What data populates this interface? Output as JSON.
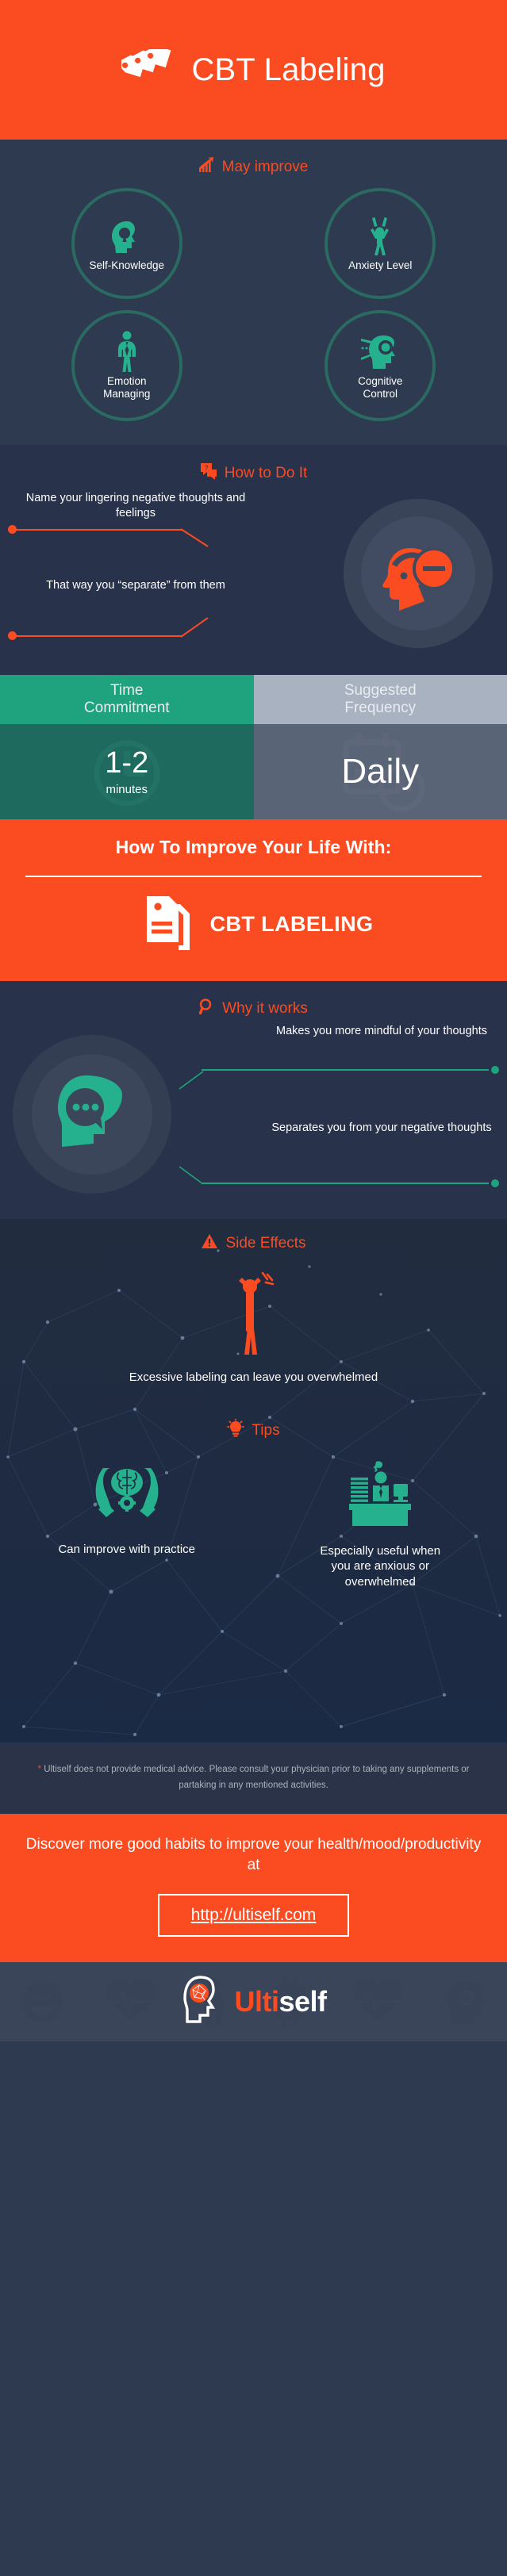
{
  "header": {
    "title": "CBT Labeling",
    "icon": "tags-icon",
    "bg": "#fa4b21"
  },
  "may_improve": {
    "heading": "May improve",
    "heading_icon": "chart-up-icon",
    "items": [
      {
        "label": "Self-Knowledge",
        "icon": "head-keyhole-icon"
      },
      {
        "label": "Anxiety Level",
        "icon": "person-celebrate-icon"
      },
      {
        "label": "Emotion\nManaging",
        "label_line1": "Emotion",
        "label_line2": "Managing",
        "icon": "person-tie-icon"
      },
      {
        "label": "Cognitive\nControl",
        "label_line1": "Cognitive",
        "label_line2": "Control",
        "icon": "head-gear-icon"
      }
    ]
  },
  "how_to": {
    "heading": "How to Do It",
    "heading_icon": "question-bubble-icon",
    "illustration_icon": "head-minus-icon",
    "steps": [
      "Name your lingering negative thoughts and feelings",
      "That way you “separate” from them"
    ]
  },
  "stats": {
    "time": {
      "header": "Time Commitment",
      "header_line1": "Time",
      "header_line2": "Commitment",
      "value": "1-2",
      "unit": "minutes",
      "bg_icon": "clock-icon",
      "header_bg": "#1fa37e",
      "body_bg": "#1f6a5e"
    },
    "frequency": {
      "header": "Suggested Frequency",
      "header_line1": "Suggested",
      "header_line2": "Frequency",
      "value": "Daily",
      "unit": "",
      "bg_icon": "calendar-clock-icon",
      "header_bg": "#a9b2c0",
      "body_bg": "#5a6477"
    }
  },
  "band": {
    "title": "How To Improve Your Life With:",
    "logo_text": "CBT LABELING",
    "logo_icon": "tag-lines-icon"
  },
  "why": {
    "heading": "Why it works",
    "heading_icon": "magnifier-icon",
    "illustration_icon": "head-speech-bubble-icon",
    "points": [
      "Makes you more mindful of your thoughts",
      "Separates you from your negative thoughts"
    ]
  },
  "side_effects": {
    "heading": "Side Effects",
    "heading_icon": "warning-triangle-icon",
    "figure_icon": "stressed-person-icon",
    "text": "Excessive labeling can leave you overwhelmed"
  },
  "tips": {
    "heading": "Tips",
    "heading_icon": "lightbulb-icon",
    "items": [
      {
        "text": "Can improve with practice",
        "icon": "hands-brain-icon"
      },
      {
        "text": "Especially useful when you are anxious or overwhelmed",
        "icon": "desk-worker-icon"
      }
    ]
  },
  "disclaimer": {
    "star": "*",
    "text": "Ultiself does not provide medical advice. Please consult your physician prior to taking any supplements or partaking in any mentioned activities."
  },
  "cta": {
    "text": "Discover more good habits to improve your health/mood/productivity at",
    "url": "http://ultiself.com"
  },
  "footer": {
    "brand_part1": "Ulti",
    "brand_part2": "self",
    "logo_icon": "brain-head-icon"
  },
  "colors": {
    "orange": "#fa4b21",
    "green": "#1fa37e",
    "dark_navy": "#2e3a4f",
    "darker_navy": "#28324a",
    "grey": "#a9b2c0"
  }
}
